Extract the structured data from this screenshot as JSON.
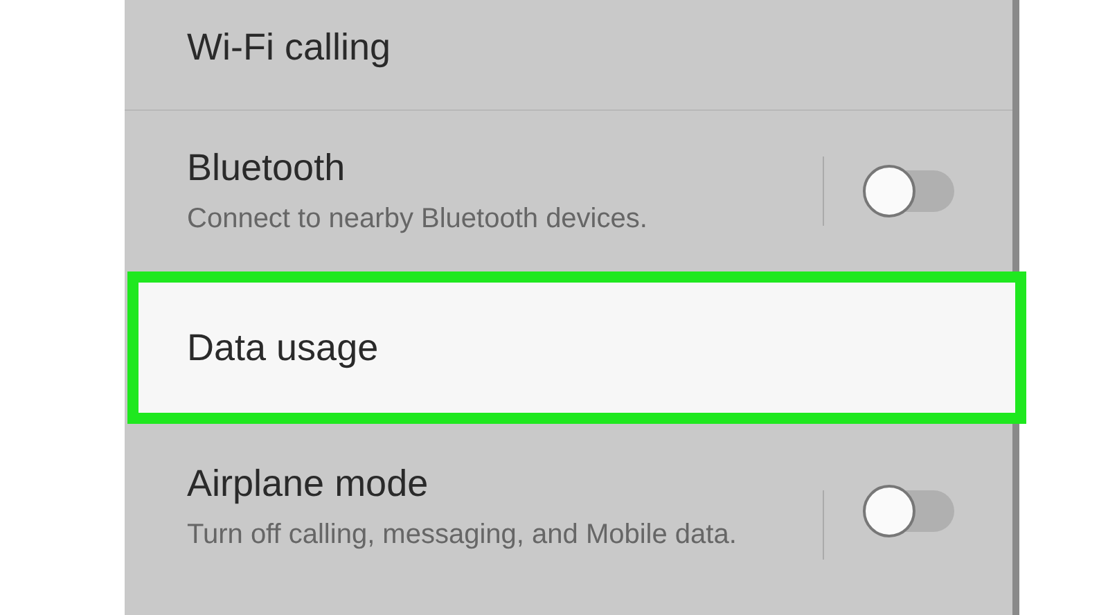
{
  "settings": [
    {
      "kind": "plain",
      "title": "Wi-Fi calling",
      "highlighted": false
    },
    {
      "kind": "toggle",
      "title": "Bluetooth",
      "subtitle": "Connect to nearby Bluetooth devices.",
      "on": false,
      "highlighted": false
    },
    {
      "kind": "plain",
      "title": "Data usage",
      "highlighted": true
    },
    {
      "kind": "toggle",
      "title": "Airplane mode",
      "subtitle": "Turn off calling, messaging, and Mobile data.",
      "on": false,
      "highlighted": false
    }
  ]
}
